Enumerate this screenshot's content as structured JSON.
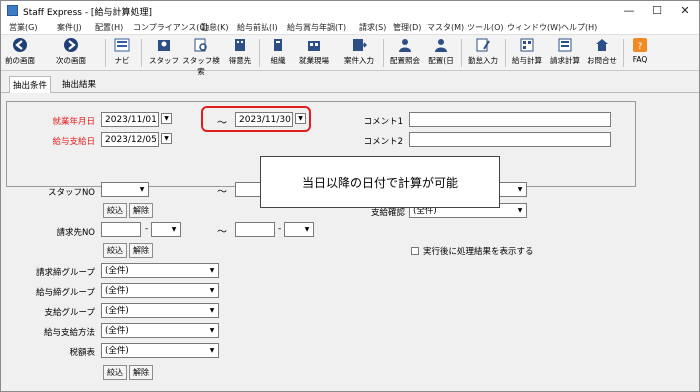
{
  "window": {
    "title": "Staff Express - [給与計算処理]",
    "min": "—",
    "max": "☐",
    "close": "✕"
  },
  "menu": [
    "営業(G)",
    "案件(J)",
    "配置(H)",
    "コンプライアンス(C)",
    "勤怠(K)",
    "給与前払(I)",
    "給与賞与年調(T)",
    "請求(S)",
    "管理(D)",
    "マスタ(M)",
    "ツール(O)",
    "ウィンドウ(W)",
    "ヘルプ(H)"
  ],
  "toolbar": {
    "back": "前の画面",
    "next": "次の画面",
    "navi": "ナビ",
    "staff": "スタッフ",
    "staff_search": "スタッフ検索",
    "client": "得意先",
    "org": "組織",
    "workplace": "就業現場",
    "case_entry": "案件入力",
    "assign_query": "配置照会",
    "assign_day": "配置(日",
    "attend_entry": "勤怠入力",
    "pay_calc": "給与計算",
    "bill_calc": "請求計算",
    "inquiry": "お問合せ",
    "faq": "FAQ"
  },
  "tabs": {
    "extract": "抽出条件",
    "result": "抽出結果"
  },
  "form": {
    "work_month_label": "就業年月日",
    "work_from": "2023/11/01",
    "work_to": "2023/11/30",
    "pay_date_label": "給与支給日",
    "pay_date": "2023/12/05",
    "comment1_label": "コメント1",
    "comment2_label": "コメント2",
    "tilde": "～",
    "staff_no_label": "スタッフNO",
    "narrow": "絞込",
    "clear": "解除",
    "pay_confirm_label": "支給確認",
    "pay_confirm_value": "(全件)",
    "bill_no_label": "請求先NO",
    "show_result_label": "実行後に処理結果を表示する",
    "billing_group_label": "請求締グループ",
    "billing_group_value": "(全件)",
    "pay_group_label": "給与締グループ",
    "pay_group_value": "(全件)",
    "payout_group_label": "支給グループ",
    "payout_group_value": "(全件)",
    "pay_method_label": "給与支給方法",
    "pay_method_value": "(全件)",
    "tax_table_label": "税額表",
    "tax_table_value": "(全件)"
  },
  "callout": "当日以降の日付で計算が可能"
}
